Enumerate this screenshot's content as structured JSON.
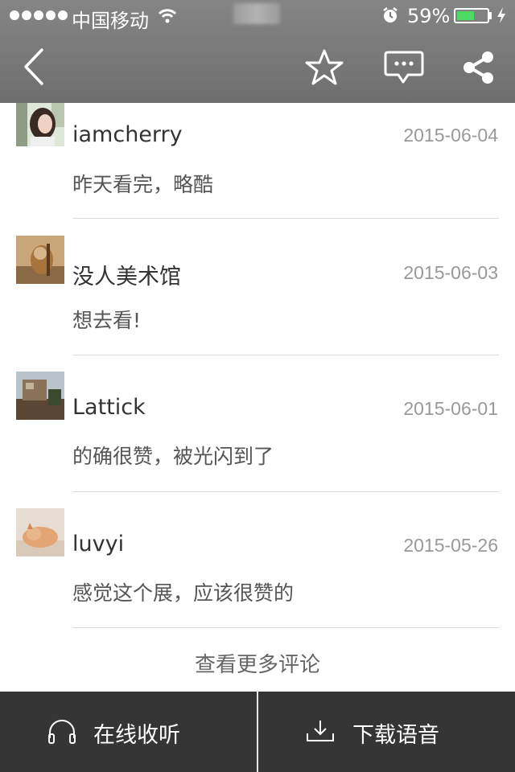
{
  "status_bar": {
    "carrier": "中国移动",
    "battery_percent": "59%",
    "battery_level": 0.59,
    "icons": [
      "signal-dots-icon",
      "wifi-icon",
      "alarm-icon",
      "battery-icon",
      "charging-bolt-icon"
    ]
  },
  "nav": {
    "icons": [
      "back-chevron-icon",
      "star-icon",
      "comment-bubble-icon",
      "share-icon"
    ]
  },
  "comments": [
    {
      "user": "iamcherry",
      "date": "2015-06-04",
      "text": "昨天看完，略酷"
    },
    {
      "user": "没人美术馆",
      "date": "2015-06-03",
      "text": "想去看!"
    },
    {
      "user": "Lattick",
      "date": "2015-06-01",
      "text": "的确很赞，被光闪到了"
    },
    {
      "user": "luvyi",
      "date": "2015-05-26",
      "text": "感觉这个展，应该很赞的"
    }
  ],
  "more_comments_label": "查看更多评论",
  "bottom_bar": {
    "listen_label": "在线收听",
    "download_label": "下载语音",
    "icons": [
      "headphones-icon",
      "download-icon"
    ]
  },
  "colors": {
    "nav_background": "#7a7a7a",
    "bottom_bar_background": "#353535",
    "battery_green": "#4cd964",
    "date_text": "#999999"
  }
}
